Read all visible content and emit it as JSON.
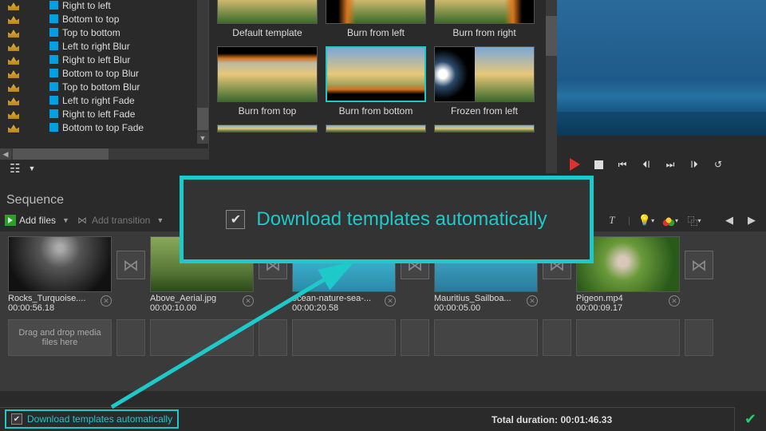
{
  "tree": {
    "items": [
      "Right to left",
      "Bottom to top",
      "Top to bottom",
      "Left to right Blur",
      "Right to left Blur",
      "Bottom to top Blur",
      "Top to bottom Blur",
      "Left to right Fade",
      "Right to left Fade",
      "Bottom to top Fade"
    ]
  },
  "gallery": {
    "items": [
      {
        "label": "Default template",
        "overlay": ""
      },
      {
        "label": "Burn from left",
        "overlay": "burn-l"
      },
      {
        "label": "Burn from right",
        "overlay": "burn-r"
      },
      {
        "label": "Burn from top",
        "overlay": "burn-t"
      },
      {
        "label": "Burn from bottom",
        "overlay": "burn-b",
        "selected": true
      },
      {
        "label": "Frozen from left",
        "overlay": "frozen-l"
      }
    ]
  },
  "sequence": {
    "title": "Sequence",
    "add_files": "Add files",
    "add_transition": "Add transition",
    "clips": [
      {
        "name": "Rocks_Turquoise....",
        "time": "00:00:56.18",
        "cls": "rocks"
      },
      {
        "name": "Above_Aerial.jpg",
        "time": "00:00:10.00",
        "cls": "aerial"
      },
      {
        "name": "ocean-nature-sea-...",
        "time": "00:00:20.58",
        "cls": "ocean"
      },
      {
        "name": "Mauritius_Sailboa...",
        "time": "00:00:05.00",
        "cls": "maur"
      },
      {
        "name": "Pigeon.mp4",
        "time": "00:00:09.17",
        "cls": "pigeon"
      }
    ],
    "drop_hint": "Drag and drop media files here"
  },
  "footer": {
    "dl_label": "Download templates automatically",
    "total_label": "Total duration: ",
    "total_value": "00:01:46.33"
  },
  "callout": {
    "text": "Download templates automatically"
  }
}
